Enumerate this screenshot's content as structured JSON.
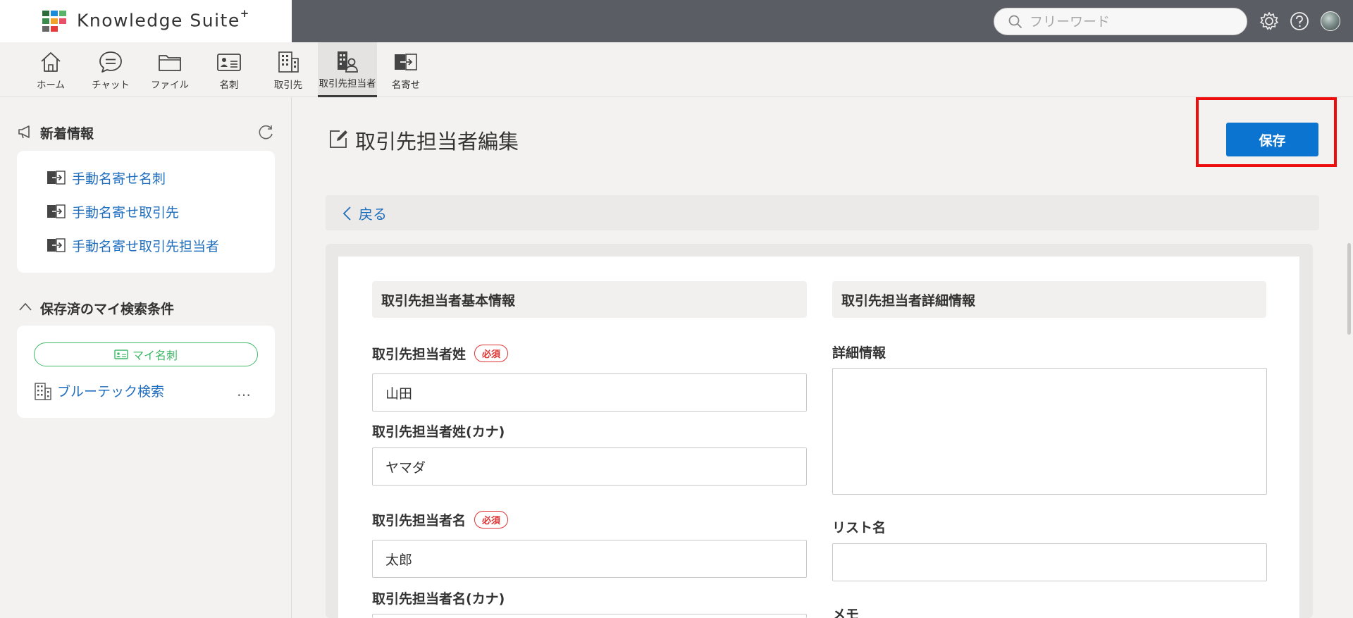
{
  "brand": {
    "name": "Knowledge Suite",
    "mark": "+"
  },
  "search": {
    "placeholder": "フリーワード"
  },
  "nav": {
    "items": [
      {
        "label": "ホーム",
        "icon": "home-icon"
      },
      {
        "label": "チャット",
        "icon": "chat-icon"
      },
      {
        "label": "ファイル",
        "icon": "folder-icon"
      },
      {
        "label": "名刺",
        "icon": "business-card-icon"
      },
      {
        "label": "取引先",
        "icon": "building-icon"
      },
      {
        "label": "取引先担当者",
        "icon": "contact-person-icon",
        "active": true
      },
      {
        "label": "名寄せ",
        "icon": "merge-icon"
      }
    ]
  },
  "sidebar": {
    "news_title": "新着情報",
    "news_links": [
      "手動名寄せ名刺",
      "手動名寄せ取引先",
      "手動名寄せ取引先担当者"
    ],
    "saved_title": "保存済のマイ検索条件",
    "pill_label": "マイ名刺",
    "saved_item": "ブルーテック検索",
    "more_label": "…"
  },
  "main": {
    "title": "取引先担当者編集",
    "save_label": "保存",
    "back_label": "戻る",
    "left_section": "取引先担当者基本情報",
    "right_section": "取引先担当者詳細情報",
    "required_badge": "必須",
    "fields": {
      "last_name_label": "取引先担当者姓",
      "last_name_value": "山田",
      "last_name_kana_label": "取引先担当者姓(カナ)",
      "last_name_kana_value": "ヤマダ",
      "first_name_label": "取引先担当者名",
      "first_name_value": "太郎",
      "first_name_kana_label": "取引先担当者名(カナ)",
      "detail_label": "詳細情報",
      "list_name_label": "リスト名",
      "memo_label": "メモ"
    }
  },
  "colors": {
    "accent": "#0b74d1",
    "link": "#1f6dbd",
    "highlight": "#ee0d0d",
    "required": "#dd3333",
    "green": "#3fb868"
  }
}
